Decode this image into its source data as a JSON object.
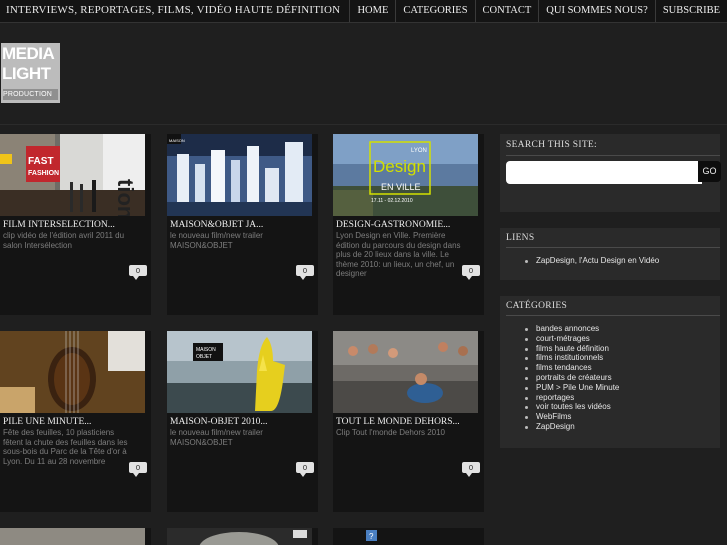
{
  "header": {
    "tagline": "INTERVIEWS, REPORTAGES, FILMS, VIDÉO HAUTE DÉFINITION",
    "nav": [
      "HOME",
      "CATEGORIES",
      "CONTACT",
      "QUI SOMMES NOUS?",
      "SUBSCRIBE"
    ]
  },
  "logo": {
    "line1": "MEDIA",
    "line2": "LIGHT",
    "line3": "PRODUCTION"
  },
  "posts": [
    {
      "title": "FILM INTERSÉLECTION...",
      "desc": "clip vidéo de l'édition avril 2011 du salon Intersélection",
      "comments": "0",
      "thumb_text": "FAST FASHION"
    },
    {
      "title": "MAISON&OBJET JA...",
      "desc": "le nouveau film/new trailer MAISON&OBJET",
      "comments": "0",
      "thumb_text": "MAISON OBJET"
    },
    {
      "title": "DESIGN-GASTRONOMIE...",
      "desc": "Lyon Design en Ville. Première édition du parcours du design dans plus de 20 lieux dans la ville. Le thème 2010: un lieux, un chef, un designer",
      "comments": "0",
      "thumb_text": "LYON Design EN VILLE 17.11 - 02.12.2010"
    },
    {
      "title": "PILE UNE MINUTE...",
      "desc": "Fête des feuilles, 10 plasticiens fêtent la chute des feuilles dans les sous-bois du Parc de la Tête d'or à Lyon. Du 11 au 28 novembre",
      "comments": "0",
      "thumb_text": ""
    },
    {
      "title": "MAISON-OBJET 2010...",
      "desc": "le nouveau film/new trailer MAISON&OBJET",
      "comments": "0",
      "thumb_text": "MAISON OBJET"
    },
    {
      "title": "TOUT LE MONDE DEHORS...",
      "desc": "Clip Tout l'monde Dehors 2010",
      "comments": "0",
      "thumb_text": ""
    }
  ],
  "sidebar": {
    "search": {
      "title": "SEARCH THIS SITE:",
      "placeholder": "",
      "button": "GO"
    },
    "links": {
      "title": "LIENS",
      "items": [
        "ZapDesign, l'Actu Design en Vidéo"
      ]
    },
    "categories": {
      "title": "CATÉGORIES",
      "items": [
        "bandes annonces",
        "court-métrages",
        "films haute définition",
        "films institutionnels",
        "films tendances",
        "portraits de créateurs",
        "PUM > Pile Une Minute",
        "reportages",
        "voir toutes les vidéos",
        "WebFilms",
        "ZapDesign"
      ]
    }
  },
  "colors": {
    "background": "#1f1f1f",
    "card": "#141414",
    "widget": "#2a2a2a",
    "muted_text": "#7d7d7d"
  }
}
